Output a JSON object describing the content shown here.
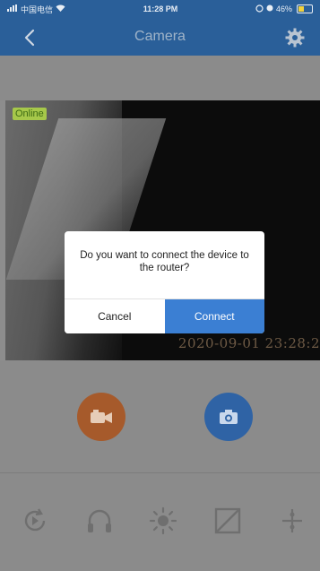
{
  "status_bar": {
    "carrier": "中国电信",
    "time": "11:28 PM",
    "battery_text": "46%",
    "battery_level": 0.46
  },
  "nav": {
    "title": "Camera",
    "back_icon": "chevron-left-icon",
    "settings_icon": "gear-icon"
  },
  "video": {
    "status_label": "Online",
    "timestamp": "2020-09-01  23:28:2"
  },
  "controls": {
    "record_icon": "video-camera-icon",
    "snapshot_icon": "camera-icon"
  },
  "toolbar": {
    "items": [
      "playback-icon",
      "headphones-icon",
      "brightness-icon",
      "contrast-icon",
      "adjust-icon"
    ]
  },
  "dialog": {
    "message": "Do you want to connect the device to the router?",
    "cancel_label": "Cancel",
    "confirm_label": "Connect"
  },
  "colors": {
    "nav_bg": "#2a5f99",
    "record_btn": "#a65a2b",
    "snapshot_btn": "#2f63a5",
    "confirm_btn": "#3b7fd3"
  }
}
